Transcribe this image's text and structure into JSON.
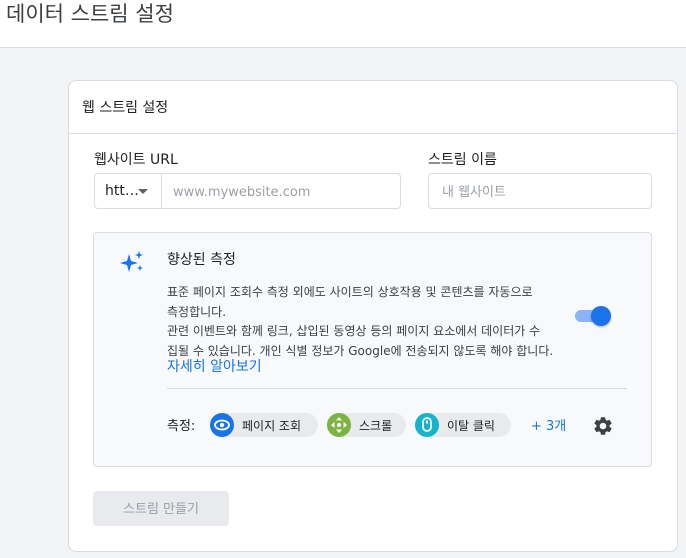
{
  "page": {
    "title": "데이터 스트림 설정"
  },
  "card": {
    "title": "웹 스트림 설정",
    "website_url": {
      "label": "웹사이트 URL",
      "protocol": "htt…",
      "placeholder": "www.mywebsite.com",
      "value": ""
    },
    "stream_name": {
      "label": "스트림 이름",
      "placeholder": "내 웹사이트",
      "value": ""
    },
    "enhanced_measurement": {
      "title": "향상된 측정",
      "description_lines": [
        "표준 페이지 조회수 측정 외에도 사이트의 상호작용 및 콘텐츠를 자동으로",
        "측정합니다.",
        "관련 이벤트와 함께 링크, 삽입된 동영상 등의 페이지 요소에서 데이터가 수",
        "집될 수 있습니다. 개인 식별 정보가 Google에 전송되지 않도록 해야 합니다."
      ],
      "learn_more": "자세히 알아보기",
      "enabled": true,
      "measure_label": "측정:",
      "chips": [
        {
          "label": "페이지 조회",
          "icon": "eye-icon",
          "color": "#1a73e8"
        },
        {
          "label": "스크롤",
          "icon": "scroll-icon",
          "color": "#7cb342"
        },
        {
          "label": "이탈 클릭",
          "icon": "mouse-icon",
          "color": "#12b5cb"
        }
      ],
      "more": "+ 3개"
    },
    "create_button": "스트림 만들기"
  },
  "colors": {
    "accent": "#1a73e8",
    "toggle_track": "#8ab4f8",
    "border": "#dadce0",
    "disabled_text": "#9aa0a6"
  }
}
